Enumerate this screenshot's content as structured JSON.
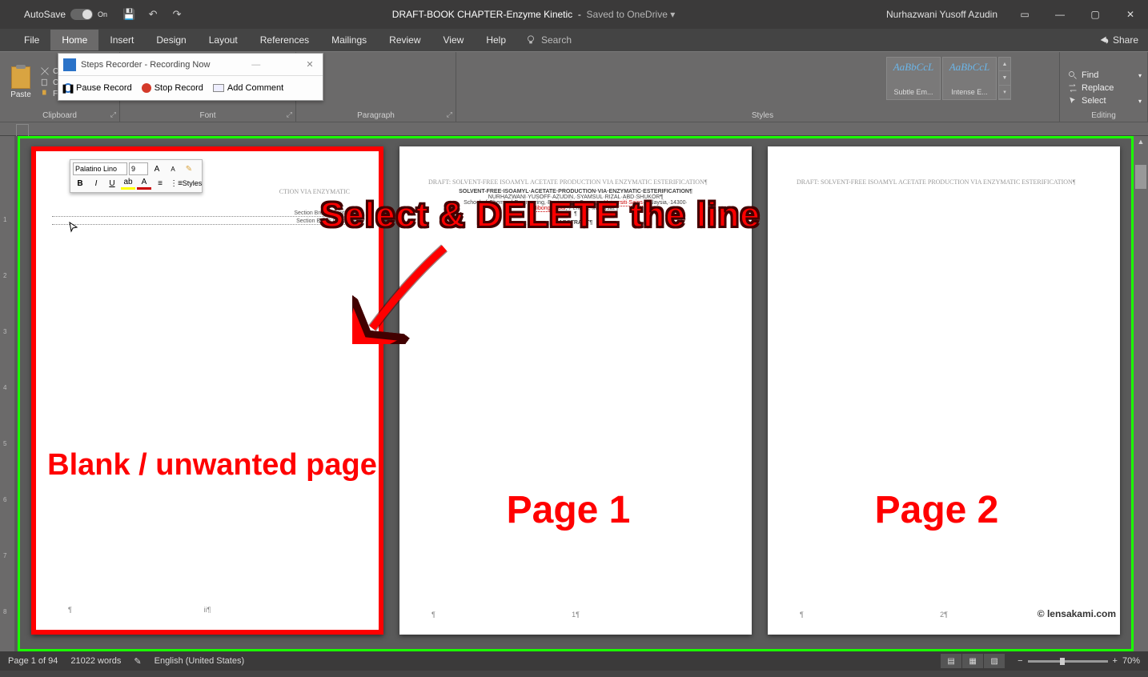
{
  "titlebar": {
    "autosave_label": "AutoSave",
    "autosave_state": "On",
    "doc_name": "DRAFT-BOOK CHAPTER-Enzyme Kinetic",
    "saved_status": "Saved to OneDrive",
    "user_name": "Nurhazwani Yusoff Azudin"
  },
  "tabs": {
    "file": "File",
    "home": "Home",
    "insert": "Insert",
    "design": "Design",
    "layout": "Layout",
    "references": "References",
    "mailings": "Mailings",
    "review": "Review",
    "view": "View",
    "help": "Help",
    "search_placeholder": "Search",
    "share": "Share"
  },
  "ribbon": {
    "clipboard": {
      "paste": "Paste",
      "cut": "Cut",
      "copy": "Copy",
      "format_painter": "Format Painter",
      "label": "Clipboard"
    },
    "font_label": "Font",
    "paragraph_label": "Paragraph",
    "styles": {
      "label": "Styles",
      "items": [
        {
          "sample": "AaBbCcL",
          "name": "Subtle Em..."
        },
        {
          "sample": "AaBbCcL",
          "name": "Intense E..."
        }
      ]
    },
    "editing": {
      "label": "Editing",
      "find": "Find",
      "replace": "Replace",
      "select": "Select"
    }
  },
  "recorder": {
    "title": "Steps Recorder - Recording Now",
    "pause": "Pause Record",
    "stop": "Stop Record",
    "comment": "Add Comment"
  },
  "minitoolbar": {
    "font": "Palatino Lino",
    "size": "9",
    "styles": "Styles"
  },
  "pages": {
    "blank": {
      "header": "CTION VIA ENZYMATIC",
      "sbreak1": "Section Break (Continuous)",
      "sbreak2": "Section Break (Next Page)",
      "footer": "ii¶"
    },
    "p1": {
      "header": "DRAFT: SOLVENT-FREE ISOAMYL ACETATE PRODUCTION VIA ENZYMATIC ESTERIFICATION¶",
      "title": "SOLVENT-FREE·ISOAMYL·ACETATE·PRODUCTION·VIA·ENZYMATIC·ESTERIFICATION¶",
      "authors": "NURHAZWANI·YUSOFF·AZUDIN,·SYAMSUL·RIZAL·ABD·SHUKOR¶",
      "affil1": "School·of·Chemical·Engineering,·Engineering·Campus,·",
      "affil_red1": "Universiti·Sains",
      "affil2": "·Malaysia,·14300·",
      "affil_red2": "Nibong·Tebal",
      "affil3": ",·Penang,·Malaysia.¶",
      "pilcrow": "¶",
      "abstract": "ABSTRACT¶",
      "footer": "1¶"
    },
    "p2": {
      "header": "DRAFT: SOLVENT-FREE ISOAMYL ACETATE PRODUCTION VIA ENZYMATIC ESTERIFICATION¶",
      "footer": "2¶"
    }
  },
  "annotations": {
    "main": "Select & DELETE the line",
    "blank": "Blank / unwanted page",
    "page1": "Page 1",
    "page2": "Page 2",
    "watermark": "© lensakami.com"
  },
  "statusbar": {
    "page": "Page 1 of 94",
    "words": "21022 words",
    "lang": "English (United States)",
    "zoom": "70%"
  },
  "ruler_v_ticks": [
    "1",
    "2",
    "3",
    "4",
    "5",
    "6",
    "7",
    "8"
  ]
}
